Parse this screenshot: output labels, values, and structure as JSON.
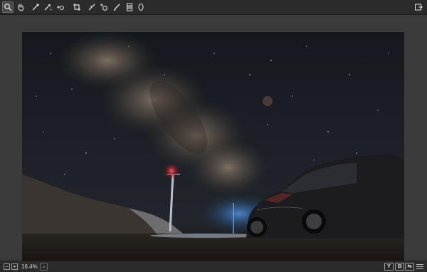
{
  "toolbar": {
    "tools": [
      "zoom-icon",
      "hand-icon",
      "eyedropper-icon",
      "color-picker-icon",
      "color-sampler-icon",
      "crop-icon",
      "straighten-icon",
      "heal-icon",
      "brush-icon",
      "gradient-icon",
      "radial-filter-icon"
    ],
    "active_tool": "zoom-icon",
    "export_icon": "export-icon"
  },
  "status": {
    "zoom_out": "−",
    "zoom_in": "+",
    "zoom_level": "16.4%",
    "zoom_dropdown": "⌄",
    "before_after_y": "Y",
    "compare_split": "⊟",
    "compare_swap": "⇆",
    "menu_icon": "hamburger-icon"
  },
  "colors": {
    "toolbar_bg": "#2b2b2b",
    "viewer_bg": "#3b3b3b"
  }
}
